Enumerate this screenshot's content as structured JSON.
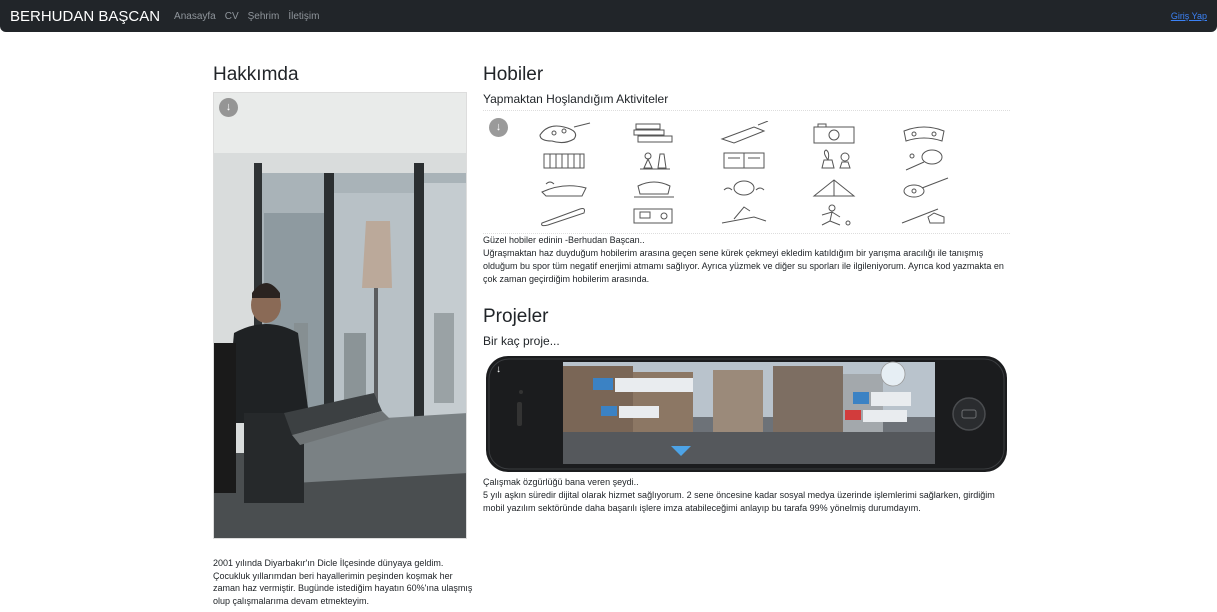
{
  "nav": {
    "brand": "BERHUDAN BAŞCAN",
    "links": [
      "Anasayfa",
      "CV",
      "Şehrim",
      "İletişim"
    ],
    "login": "Giriş Yap"
  },
  "about": {
    "title": "Hakkımda",
    "text": "2001 yılında Diyarbakır'ın Dicle İlçesinde dünyaya geldim. Çocukluk yıllarımdan beri hayallerimin peşinden koşmak her zaman haz vermiştir. Bugünde istediğim hayatın 60%'ına ulaşmış olup çalışmalarıma devam etmekteyim."
  },
  "hobbies": {
    "title": "Hobiler",
    "subtitle": "Yapmaktan Hoşlandığım Aktiviteler",
    "caption": "Güzel hobiler edinin -Berhudan Başcan..",
    "paragraph": "Uğraşmaktan haz duyduğum hobilerim arasına geçen sene kürek çekmeyi ekledim katıldığım bir yarışma aracılığı ile tanışmış olduğum bu spor tüm negatif enerjimi atmamı sağlıyor. Ayrıca yüzmek ve diğer su sporları ile ilgileniyorum. Ayrıca kod yazmakta en çok zaman geçirdiğim hobilerim arasında.",
    "icons": [
      "palette-icon",
      "books-icon",
      "music-icon",
      "camera-icon",
      "gamepad-icon",
      "piano-icon",
      "chess-icon",
      "book-icon",
      "plants-icon",
      "tennis-icon",
      "wifi-icon",
      "cooking-icon",
      "swim-icon",
      "tent-icon",
      "guitar-icon",
      "skateboard-icon",
      "sewing-icon",
      "golf-icon",
      "run-icon",
      "fishing-icon"
    ]
  },
  "projects": {
    "title": "Projeler",
    "subtitle": "Bir kaç proje...",
    "caption": "Çalışmak özgürlüğü bana veren şeydi..",
    "paragraph": "5 yılı aşkın süredir dijital olarak hizmet sağlıyorum. 2 sene öncesine kadar sosyal medya üzerinde işlemlerimi sağlarken, girdiğim mobil yazılım sektöründe daha başarılı işlere imza atabileceğimi anlayıp bu tarafa 99% yönelmiş durumdayım."
  },
  "colors": {
    "navbar": "#212529",
    "link": "#3b82f6"
  }
}
